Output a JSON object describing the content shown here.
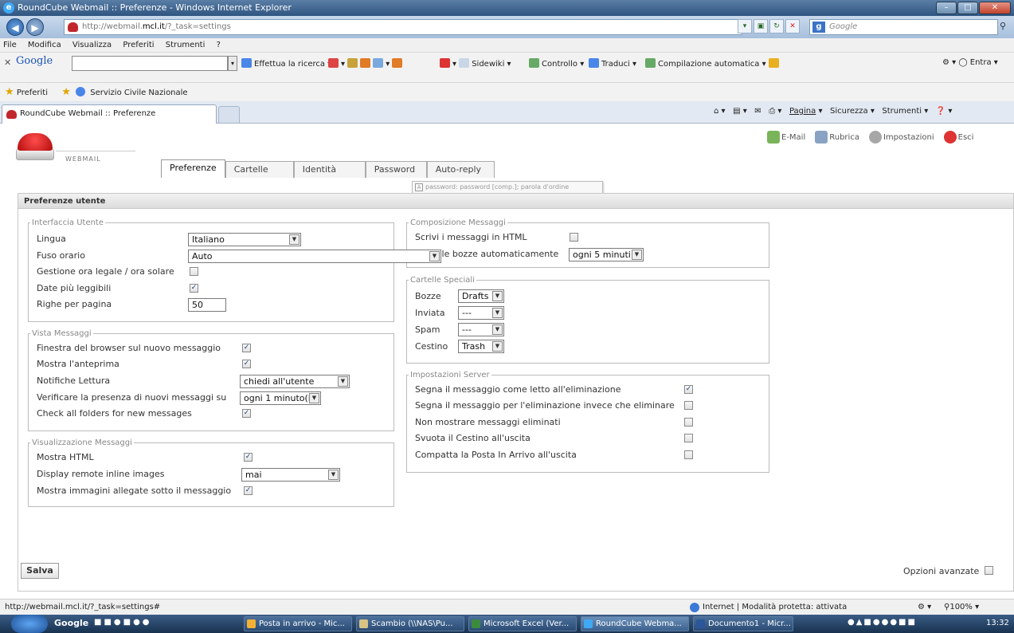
{
  "window": {
    "title": "RoundCube Webmail :: Preferenze - Windows Internet Explorer"
  },
  "browser": {
    "address_prefix": "http://webmail.",
    "address_host": "mcl.it",
    "address_suffix": "/?_task=settings",
    "search_placeholder": "Google",
    "menu": [
      "File",
      "Modifica",
      "Visualizza",
      "Preferiti",
      "Strumenti",
      "?"
    ],
    "google_toolbar": {
      "logo": "Google",
      "search": "Effettua la ricerca",
      "sidewiki": "Sidewiki",
      "check": "Controllo",
      "translate": "Traduci",
      "autofill": "Compilazione automatica",
      "signin": "Entra"
    },
    "favorites": {
      "label": "Preferiti",
      "item": "Servizio Civile Nazionale"
    },
    "tab_title": "RoundCube Webmail :: Preferenze",
    "commands": {
      "page": "Pagina",
      "security": "Sicurezza",
      "tools": "Strumenti"
    }
  },
  "app": {
    "logo_text": "WEBMAIL",
    "topnav": {
      "email": "E-Mail",
      "contacts": "Rubrica",
      "settings": "Impostazioni",
      "logout": "Esci"
    },
    "tabs": [
      "Preferenze",
      "Cartelle",
      "Identità",
      "Password",
      "Auto-reply"
    ],
    "tooltip": "password: password [comp.]; parola d'ordine",
    "panel_title": "Preferenze utente",
    "ui": {
      "legend": "Interfaccia Utente",
      "language_label": "Lingua",
      "language_value": "Italiano",
      "timezone_label": "Fuso orario",
      "timezone_value": "Auto",
      "dst_label": "Gestione ora legale / ora solare",
      "pretty_dates_label": "Date più leggibili",
      "rows_label": "Righe per pagina",
      "rows_value": "50"
    },
    "view": {
      "legend": "Vista Messaggi",
      "new_window_label": "Finestra del browser sul nuovo messaggio",
      "preview_label": "Mostra l'anteprima",
      "receipts_label": "Notifiche Lettura",
      "receipts_value": "chiedi all'utente",
      "check_new_label": "Verificare la presenza di nuovi messaggi su",
      "check_new_value": "ogni 1 minuto(i)",
      "check_all_label": "Check all folders for new messages"
    },
    "display": {
      "legend": "Visualizzazione Messaggi",
      "show_html_label": "Mostra HTML",
      "remote_images_label": "Display remote inline images",
      "remote_images_value": "mai",
      "inline_attach_label": "Mostra immagini allegate sotto il messaggio"
    },
    "compose": {
      "legend": "Composizione Messaggi",
      "html_label": "Scrivi i messaggi in HTML",
      "draft_label": "Salva le bozze automaticamente",
      "draft_value": "ogni 5 minuti"
    },
    "folders": {
      "legend": "Cartelle Speciali",
      "drafts_label": "Bozze",
      "drafts_value": "Drafts",
      "sent_label": "Inviata",
      "sent_value": "---",
      "spam_label": "Spam",
      "spam_value": "---",
      "trash_label": "Cestino",
      "trash_value": "Trash"
    },
    "server": {
      "legend": "Impostazioni Server",
      "read_on_delete_label": "Segna il messaggio come letto all'eliminazione",
      "flag_delete_label": "Segna il messaggio per l'eliminazione invece che eliminare",
      "hide_deleted_label": "Non mostrare messaggi eliminati",
      "empty_trash_label": "Svuota il Cestino all'uscita",
      "compact_label": "Compatta la Posta In Arrivo all'uscita"
    },
    "save_label": "Salva",
    "advanced_label": "Opzioni avanzate"
  },
  "status": {
    "url": "http://webmail.mcl.it/?_task=settings#",
    "zone": "Internet | Modalità protetta: attivata",
    "zoom": "100%"
  },
  "taskbar": {
    "google": "Google",
    "items": [
      "Posta in arrivo - Mic...",
      "Scambio (\\\\NAS\\Pu...",
      "Microsoft Excel (Ver...",
      "RoundCube Webma...",
      "Documento1 - Micr..."
    ],
    "clock": "13:32"
  },
  "colors": {
    "accent": "#c0282d",
    "titlebar": "#2f5580",
    "check": "#1c3d7a"
  }
}
